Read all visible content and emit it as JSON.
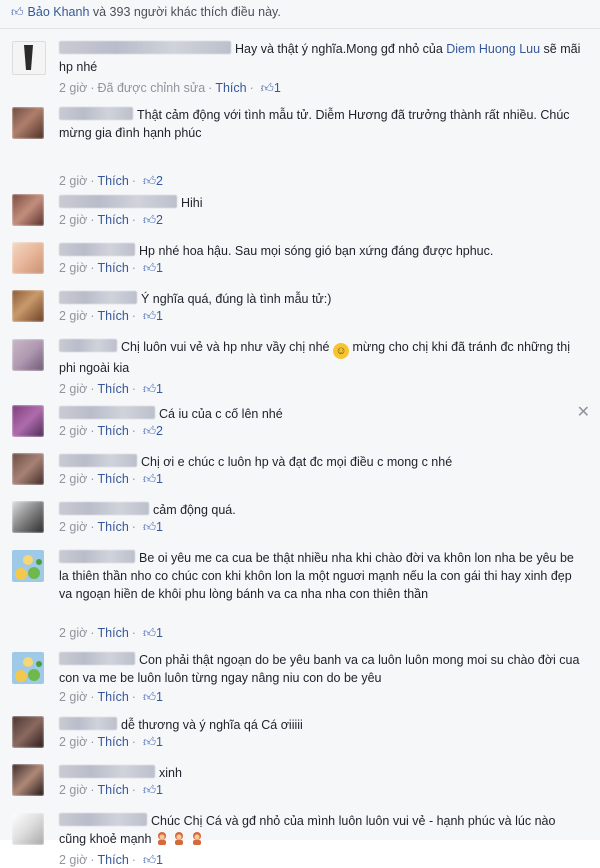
{
  "likes": {
    "icon": "thumbs-up-icon",
    "text_prefix": "Bảo Khanh",
    "text_suffix": " và 393 người khác thích điều này."
  },
  "comments": [
    {
      "text": "Hay và thật ý nghĩa.Mong gđ nhỏ của ",
      "mention": "Diem Huong Luu",
      "text_after": " sẽ mãi hp nhé",
      "time": "2 giờ",
      "edited": "Đã được chỉnh sửa",
      "like_label": "Thích",
      "like_count": "1"
    },
    {
      "text": "Thật cảm động với tình mẫu tử. Diễm Hương đã trưởng thành rất nhiều. Chúc mừng gia đình hạnh phúc",
      "time": "2 giờ",
      "like_label": "Thích",
      "like_count": "2"
    },
    {
      "text": "Hihi",
      "time": "2 giờ",
      "like_label": "Thích",
      "like_count": "2"
    },
    {
      "text": "Hp nhé hoa hậu. Sau mọi sóng gió bạn xứng đáng được hphuc.",
      "time": "2 giờ",
      "like_label": "Thích",
      "like_count": "1"
    },
    {
      "text": "Ý nghĩa quá, đúng là tình mẫu tử:)",
      "time": "2 giờ",
      "like_label": "Thích",
      "like_count": "1"
    },
    {
      "text": "Chị luôn vui vẻ và hp như vầy chị nhé ",
      "text_after": " mừng cho chị khi đã tránh đc những thị phi ngoài kia",
      "time": "2 giờ",
      "like_label": "Thích",
      "like_count": "1"
    },
    {
      "text": "Cá iu của c cố lên nhé",
      "time": "2 giờ",
      "like_label": "Thích",
      "like_count": "2"
    },
    {
      "text": "Chị ơi e chúc c luôn hp và đạt đc mọi điều c mong c nhé",
      "time": "2 giờ",
      "like_label": "Thích",
      "like_count": "1"
    },
    {
      "text": "cảm động quá.",
      "time": "2 giờ",
      "like_label": "Thích",
      "like_count": "1"
    },
    {
      "text": "Be oi yêu me ca cua be thật nhiều nha khi chào đời va khôn lon nha be yêu be la thiên thần nho co chúc con khi khôn lon la một nguơi mạnh nếu la con gái thi hay xinh đẹp va ngoạn hiền de khôi phu lòng bánh va ca nha nha con thiên thần",
      "time": "2 giờ",
      "like_label": "Thích",
      "like_count": "1"
    },
    {
      "text": "Con phải thật ngoạn do be yêu banh va ca luôn luôn mong moi su chào đời cua con va me be luôn luôn từng ngay nâng niu con do be yêu",
      "time": "2 giờ",
      "like_label": "Thích",
      "like_count": "1"
    },
    {
      "text": "dễ thương và ý nghĩa qá Cá ơiiiii",
      "time": "2 giờ",
      "like_label": "Thích",
      "like_count": "1"
    },
    {
      "text": "xinh",
      "time": "2 giờ",
      "like_label": "Thích",
      "like_count": "1"
    },
    {
      "text": "Chúc Chị Cá và gđ nhỏ của mình luôn luôn vui vẻ - hạnh phúc và lúc nào cũng khoẻ mạnh ",
      "time": "2 giờ",
      "like_label": "Thích",
      "like_count": "1"
    }
  ],
  "icons": {
    "like": "thumbs-up-icon",
    "close": "close-icon",
    "smile": "smile-emoji-icon",
    "girl": "girl-emoji-icon"
  },
  "colors": {
    "link": "#365899",
    "meta": "#90949c",
    "background": "#f6f7f9"
  }
}
